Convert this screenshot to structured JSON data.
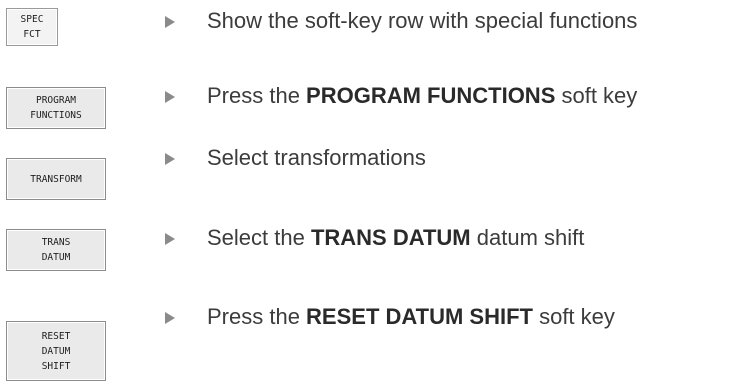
{
  "steps": [
    {
      "key_lines": [
        "SPEC",
        "FCT"
      ],
      "text_before": "Show the soft-key row with special functions",
      "text_bold": "",
      "text_after": ""
    },
    {
      "key_lines": [
        "PROGRAM",
        "FUNCTIONS"
      ],
      "text_before": "Press the ",
      "text_bold": "PROGRAM FUNCTIONS",
      "text_after": " soft key"
    },
    {
      "key_lines": [
        "TRANSFORM"
      ],
      "text_before": "Select transformations",
      "text_bold": "",
      "text_after": ""
    },
    {
      "key_lines": [
        "TRANS",
        "DATUM"
      ],
      "text_before": "Select the ",
      "text_bold": "TRANS DATUM",
      "text_after": " datum shift"
    },
    {
      "key_lines": [
        "RESET",
        "DATUM",
        "SHIFT"
      ],
      "text_before": "Press the ",
      "text_bold": "RESET DATUM SHIFT",
      "text_after": " soft key"
    }
  ],
  "icons": {
    "step_arrow": "triangle-right-icon"
  },
  "colors": {
    "arrow": "#8a8a8a",
    "text": "#3c3c3c"
  }
}
